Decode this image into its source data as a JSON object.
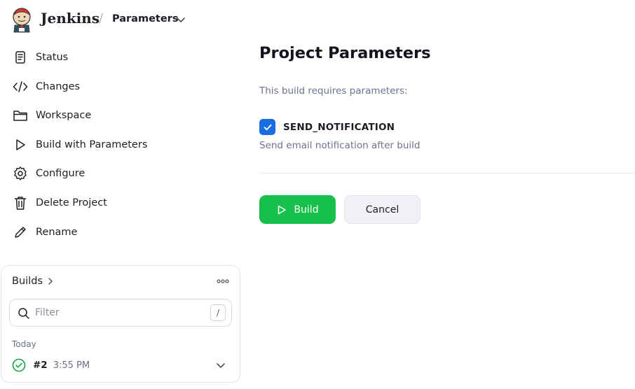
{
  "header": {
    "brand": "Jenkins",
    "separator": "/",
    "breadcrumb": "Parameters"
  },
  "sidebar": {
    "items": [
      {
        "label": "Status",
        "icon": "status-document-icon"
      },
      {
        "label": "Changes",
        "icon": "code-icon"
      },
      {
        "label": "Workspace",
        "icon": "folder-icon"
      },
      {
        "label": "Build with Parameters",
        "icon": "play-icon"
      },
      {
        "label": "Configure",
        "icon": "gear-icon"
      },
      {
        "label": "Delete Project",
        "icon": "trash-icon"
      },
      {
        "label": "Rename",
        "icon": "pencil-icon"
      }
    ]
  },
  "builds": {
    "title": "Builds",
    "filter_placeholder": "Filter",
    "shortcut": "/",
    "group": "Today",
    "items": [
      {
        "number": "#2",
        "time": "3:55 PM",
        "status": "success"
      }
    ]
  },
  "main": {
    "title": "Project Parameters",
    "subtitle": "This build requires parameters:",
    "parameter": {
      "name": "SEND_NOTIFICATION",
      "checked": true,
      "description": "Send email notification after build"
    },
    "build_label": "Build",
    "cancel_label": "Cancel"
  },
  "colors": {
    "accent_blue": "#1a6ce3",
    "build_green": "#16c04a",
    "success_green": "#16a34a",
    "muted_text": "#6b7390"
  }
}
